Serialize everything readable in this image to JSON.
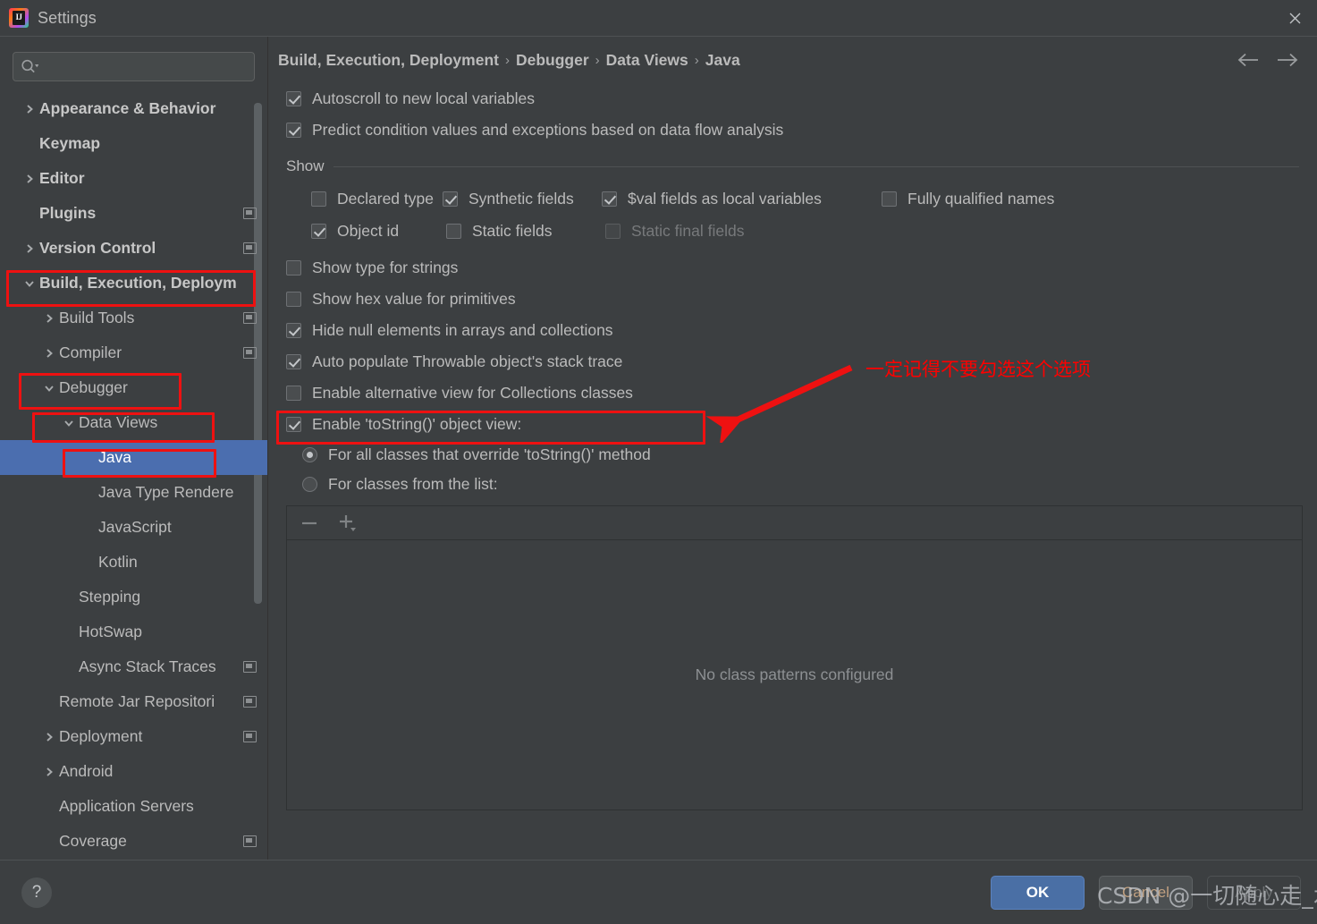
{
  "window": {
    "title": "Settings",
    "app_icon": "intellij-idea-icon",
    "close_icon": "close-icon"
  },
  "sidebar": {
    "search": {
      "placeholder": "",
      "value": "",
      "icon": "search-icon"
    },
    "items": [
      {
        "label": "Appearance & Behavior",
        "arrow": "collapsed",
        "bold": true,
        "badge": false,
        "indent": 0,
        "selected": false
      },
      {
        "label": "Keymap",
        "arrow": "none",
        "bold": true,
        "badge": false,
        "indent": 0,
        "selected": false
      },
      {
        "label": "Editor",
        "arrow": "collapsed",
        "bold": true,
        "badge": false,
        "indent": 0,
        "selected": false
      },
      {
        "label": "Plugins",
        "arrow": "none",
        "bold": true,
        "badge": true,
        "indent": 0,
        "selected": false
      },
      {
        "label": "Version Control",
        "arrow": "collapsed",
        "bold": true,
        "badge": true,
        "indent": 0,
        "selected": false
      },
      {
        "label": "Build, Execution, Deploym",
        "arrow": "expanded",
        "bold": true,
        "badge": false,
        "indent": 0,
        "selected": false
      },
      {
        "label": "Build Tools",
        "arrow": "collapsed",
        "bold": false,
        "badge": true,
        "indent": 1,
        "selected": false
      },
      {
        "label": "Compiler",
        "arrow": "collapsed",
        "bold": false,
        "badge": true,
        "indent": 1,
        "selected": false
      },
      {
        "label": "Debugger",
        "arrow": "expanded",
        "bold": false,
        "badge": false,
        "indent": 1,
        "selected": false
      },
      {
        "label": "Data Views",
        "arrow": "expanded",
        "bold": false,
        "badge": false,
        "indent": 2,
        "selected": false
      },
      {
        "label": "Java",
        "arrow": "none",
        "bold": false,
        "badge": false,
        "indent": 3,
        "selected": true
      },
      {
        "label": "Java Type Rendere",
        "arrow": "none",
        "bold": false,
        "badge": false,
        "indent": 3,
        "selected": false
      },
      {
        "label": "JavaScript",
        "arrow": "none",
        "bold": false,
        "badge": false,
        "indent": 3,
        "selected": false
      },
      {
        "label": "Kotlin",
        "arrow": "none",
        "bold": false,
        "badge": false,
        "indent": 3,
        "selected": false
      },
      {
        "label": "Stepping",
        "arrow": "none",
        "bold": false,
        "badge": false,
        "indent": 2,
        "selected": false
      },
      {
        "label": "HotSwap",
        "arrow": "none",
        "bold": false,
        "badge": false,
        "indent": 2,
        "selected": false
      },
      {
        "label": "Async Stack Traces",
        "arrow": "none",
        "bold": false,
        "badge": true,
        "indent": 2,
        "selected": false
      },
      {
        "label": "Remote Jar Repositori",
        "arrow": "none",
        "bold": false,
        "badge": true,
        "indent": 1,
        "selected": false
      },
      {
        "label": "Deployment",
        "arrow": "collapsed",
        "bold": false,
        "badge": true,
        "indent": 1,
        "selected": false
      },
      {
        "label": "Android",
        "arrow": "collapsed",
        "bold": false,
        "badge": false,
        "indent": 1,
        "selected": false
      },
      {
        "label": "Application Servers",
        "arrow": "none",
        "bold": false,
        "badge": false,
        "indent": 1,
        "selected": false
      },
      {
        "label": "Coverage",
        "arrow": "none",
        "bold": false,
        "badge": true,
        "indent": 1,
        "selected": false
      }
    ]
  },
  "breadcrumb": {
    "crumbs": [
      "Build, Execution, Deployment",
      "Debugger",
      "Data Views",
      "Java"
    ],
    "separator": "›",
    "back_icon": "arrow-left-icon",
    "forward_icon": "arrow-right-icon"
  },
  "main": {
    "top_checkboxes": [
      {
        "label": "Autoscroll to new local variables",
        "checked": true,
        "disabled": false
      },
      {
        "label": "Predict condition values and exceptions based on data flow analysis",
        "checked": true,
        "disabled": false
      }
    ],
    "show_group": {
      "title": "Show",
      "row1": [
        {
          "label": "Declared type",
          "checked": false,
          "disabled": false
        },
        {
          "label": "Synthetic fields",
          "checked": true,
          "disabled": false
        },
        {
          "label": "$val fields as local variables",
          "checked": true,
          "disabled": false
        },
        {
          "label": "Fully qualified names",
          "checked": false,
          "disabled": false
        }
      ],
      "row2": [
        {
          "label": "Object id",
          "checked": true,
          "disabled": false
        },
        {
          "label": "Static fields",
          "checked": false,
          "disabled": false
        },
        {
          "label": "Static final fields",
          "checked": false,
          "disabled": true
        }
      ]
    },
    "mid_checkboxes": [
      {
        "label": "Show type for strings",
        "checked": false,
        "disabled": false
      },
      {
        "label": "Show hex value for primitives",
        "checked": false,
        "disabled": false
      },
      {
        "label": "Hide null elements in arrays and collections",
        "checked": true,
        "disabled": false
      },
      {
        "label": "Auto populate Throwable object's stack trace",
        "checked": true,
        "disabled": false
      },
      {
        "label": "Enable alternative view for Collections classes",
        "checked": false,
        "disabled": false
      }
    ],
    "tostring": {
      "label": "Enable 'toString()' object view:",
      "checked": true,
      "options": [
        {
          "label": "For all classes that override 'toString()' method",
          "selected": true
        },
        {
          "label": "For classes from the list:",
          "selected": false
        }
      ]
    },
    "list_panel": {
      "remove_icon": "minus-icon",
      "add_icon": "plus-icon",
      "empty_text": "No class patterns configured"
    }
  },
  "footer": {
    "help_label": "?",
    "ok_label": "OK",
    "cancel_label": "Cancel",
    "apply_label": "Apply"
  },
  "annotations": {
    "note_text": "一定记得不要勾选这个选项",
    "note_color": "#ff0000",
    "arrow_color": "#ee1111",
    "box_color": "#ee1111",
    "watermark": "CSDN @一切随心走_水瓶"
  }
}
